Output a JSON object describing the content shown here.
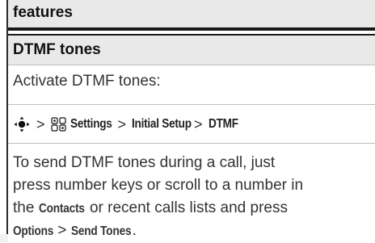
{
  "header": {
    "section_label": "features"
  },
  "topic": {
    "title": "DTMF tones"
  },
  "intro": {
    "text": "Activate DTMF tones:"
  },
  "menu_path": {
    "separator": ">",
    "settings_label": "Settings",
    "initial_setup_label": "Initial Setup",
    "dtmf_label": "DTMF",
    "nav_icon": "nav-key-icon",
    "settings_icon": "settings-icon"
  },
  "body": {
    "line1": "To send DTMF tones during a call, just",
    "line2": "press number keys or scroll to a number in",
    "line3_prefix": "the ",
    "line3_contacts": "Contacts",
    "line3_suffix": " or recent calls lists and press",
    "line4_options": "Options",
    "line4_separator": " > ",
    "line4_send_tones": "Send Tones",
    "line4_period": "."
  }
}
